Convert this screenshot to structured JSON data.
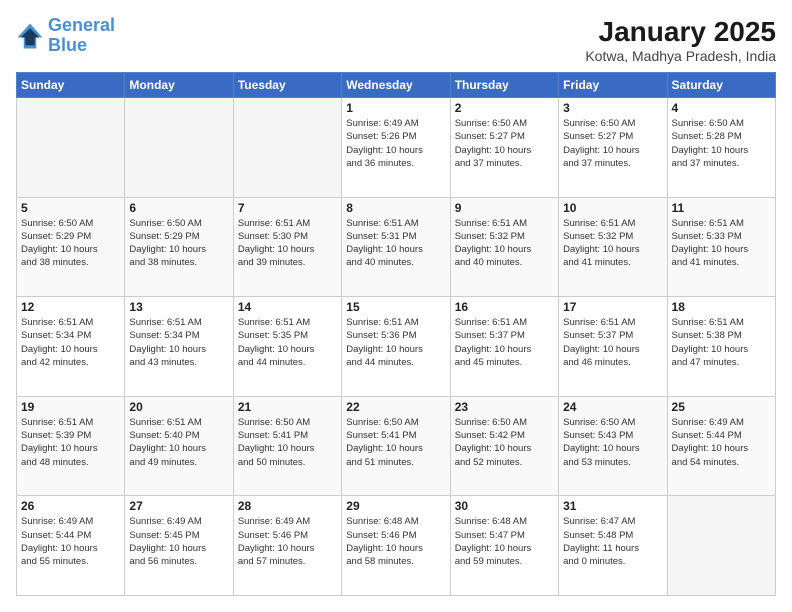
{
  "logo": {
    "line1": "General",
    "line2": "Blue"
  },
  "title": "January 2025",
  "subtitle": "Kotwa, Madhya Pradesh, India",
  "days_header": [
    "Sunday",
    "Monday",
    "Tuesday",
    "Wednesday",
    "Thursday",
    "Friday",
    "Saturday"
  ],
  "weeks": [
    [
      {
        "day": "",
        "info": ""
      },
      {
        "day": "",
        "info": ""
      },
      {
        "day": "",
        "info": ""
      },
      {
        "day": "1",
        "info": "Sunrise: 6:49 AM\nSunset: 5:26 PM\nDaylight: 10 hours\nand 36 minutes."
      },
      {
        "day": "2",
        "info": "Sunrise: 6:50 AM\nSunset: 5:27 PM\nDaylight: 10 hours\nand 37 minutes."
      },
      {
        "day": "3",
        "info": "Sunrise: 6:50 AM\nSunset: 5:27 PM\nDaylight: 10 hours\nand 37 minutes."
      },
      {
        "day": "4",
        "info": "Sunrise: 6:50 AM\nSunset: 5:28 PM\nDaylight: 10 hours\nand 37 minutes."
      }
    ],
    [
      {
        "day": "5",
        "info": "Sunrise: 6:50 AM\nSunset: 5:29 PM\nDaylight: 10 hours\nand 38 minutes."
      },
      {
        "day": "6",
        "info": "Sunrise: 6:50 AM\nSunset: 5:29 PM\nDaylight: 10 hours\nand 38 minutes."
      },
      {
        "day": "7",
        "info": "Sunrise: 6:51 AM\nSunset: 5:30 PM\nDaylight: 10 hours\nand 39 minutes."
      },
      {
        "day": "8",
        "info": "Sunrise: 6:51 AM\nSunset: 5:31 PM\nDaylight: 10 hours\nand 40 minutes."
      },
      {
        "day": "9",
        "info": "Sunrise: 6:51 AM\nSunset: 5:32 PM\nDaylight: 10 hours\nand 40 minutes."
      },
      {
        "day": "10",
        "info": "Sunrise: 6:51 AM\nSunset: 5:32 PM\nDaylight: 10 hours\nand 41 minutes."
      },
      {
        "day": "11",
        "info": "Sunrise: 6:51 AM\nSunset: 5:33 PM\nDaylight: 10 hours\nand 41 minutes."
      }
    ],
    [
      {
        "day": "12",
        "info": "Sunrise: 6:51 AM\nSunset: 5:34 PM\nDaylight: 10 hours\nand 42 minutes."
      },
      {
        "day": "13",
        "info": "Sunrise: 6:51 AM\nSunset: 5:34 PM\nDaylight: 10 hours\nand 43 minutes."
      },
      {
        "day": "14",
        "info": "Sunrise: 6:51 AM\nSunset: 5:35 PM\nDaylight: 10 hours\nand 44 minutes."
      },
      {
        "day": "15",
        "info": "Sunrise: 6:51 AM\nSunset: 5:36 PM\nDaylight: 10 hours\nand 44 minutes."
      },
      {
        "day": "16",
        "info": "Sunrise: 6:51 AM\nSunset: 5:37 PM\nDaylight: 10 hours\nand 45 minutes."
      },
      {
        "day": "17",
        "info": "Sunrise: 6:51 AM\nSunset: 5:37 PM\nDaylight: 10 hours\nand 46 minutes."
      },
      {
        "day": "18",
        "info": "Sunrise: 6:51 AM\nSunset: 5:38 PM\nDaylight: 10 hours\nand 47 minutes."
      }
    ],
    [
      {
        "day": "19",
        "info": "Sunrise: 6:51 AM\nSunset: 5:39 PM\nDaylight: 10 hours\nand 48 minutes."
      },
      {
        "day": "20",
        "info": "Sunrise: 6:51 AM\nSunset: 5:40 PM\nDaylight: 10 hours\nand 49 minutes."
      },
      {
        "day": "21",
        "info": "Sunrise: 6:50 AM\nSunset: 5:41 PM\nDaylight: 10 hours\nand 50 minutes."
      },
      {
        "day": "22",
        "info": "Sunrise: 6:50 AM\nSunset: 5:41 PM\nDaylight: 10 hours\nand 51 minutes."
      },
      {
        "day": "23",
        "info": "Sunrise: 6:50 AM\nSunset: 5:42 PM\nDaylight: 10 hours\nand 52 minutes."
      },
      {
        "day": "24",
        "info": "Sunrise: 6:50 AM\nSunset: 5:43 PM\nDaylight: 10 hours\nand 53 minutes."
      },
      {
        "day": "25",
        "info": "Sunrise: 6:49 AM\nSunset: 5:44 PM\nDaylight: 10 hours\nand 54 minutes."
      }
    ],
    [
      {
        "day": "26",
        "info": "Sunrise: 6:49 AM\nSunset: 5:44 PM\nDaylight: 10 hours\nand 55 minutes."
      },
      {
        "day": "27",
        "info": "Sunrise: 6:49 AM\nSunset: 5:45 PM\nDaylight: 10 hours\nand 56 minutes."
      },
      {
        "day": "28",
        "info": "Sunrise: 6:49 AM\nSunset: 5:46 PM\nDaylight: 10 hours\nand 57 minutes."
      },
      {
        "day": "29",
        "info": "Sunrise: 6:48 AM\nSunset: 5:46 PM\nDaylight: 10 hours\nand 58 minutes."
      },
      {
        "day": "30",
        "info": "Sunrise: 6:48 AM\nSunset: 5:47 PM\nDaylight: 10 hours\nand 59 minutes."
      },
      {
        "day": "31",
        "info": "Sunrise: 6:47 AM\nSunset: 5:48 PM\nDaylight: 11 hours\nand 0 minutes."
      },
      {
        "day": "",
        "info": ""
      }
    ]
  ]
}
